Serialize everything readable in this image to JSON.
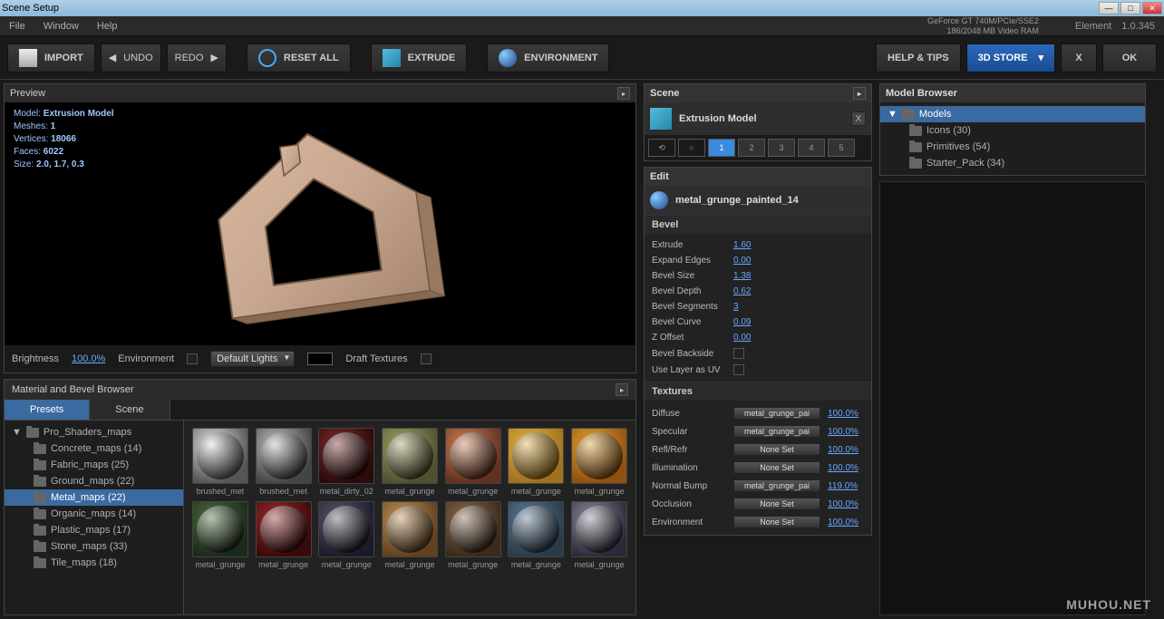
{
  "window": {
    "title": "Scene Setup"
  },
  "menubar": {
    "file": "File",
    "window": "Window",
    "help": "Help",
    "gpu": "GeForce GT 740M/PCIe/SSE2",
    "vram": "186/2048 MB Video RAM",
    "app": "Element",
    "ver": "1.0.345"
  },
  "toolbar": {
    "import": "IMPORT",
    "undo": "UNDO",
    "redo": "REDO",
    "reset": "RESET ALL",
    "extrude": "EXTRUDE",
    "environment": "ENVIRONMENT",
    "help_tips": "HELP & TIPS",
    "store": "3D STORE",
    "x": "X",
    "ok": "OK"
  },
  "preview": {
    "title": "Preview",
    "model_label": "Model:",
    "model": "Extrusion Model",
    "meshes_label": "Meshes:",
    "meshes": "1",
    "vertices_label": "Vertices:",
    "vertices": "18066",
    "faces_label": "Faces:",
    "faces": "6022",
    "size_label": "Size:",
    "size": "2.0, 1.7, 0.3",
    "brightness_label": "Brightness",
    "brightness": "100.0%",
    "env_label": "Environment",
    "lights": "Default Lights",
    "draft_label": "Draft Textures"
  },
  "material_panel": {
    "title": "Material and Bevel Browser",
    "tabs": {
      "presets": "Presets",
      "scene": "Scene"
    },
    "tree_root": "Pro_Shaders_maps",
    "folders": [
      {
        "label": "Concrete_maps (14)"
      },
      {
        "label": "Fabric_maps (25)"
      },
      {
        "label": "Ground_maps (22)"
      },
      {
        "label": "Metal_maps (22)",
        "selected": true
      },
      {
        "label": "Organic_maps (14)"
      },
      {
        "label": "Plastic_maps (17)"
      },
      {
        "label": "Stone_maps (33)"
      },
      {
        "label": "Tile_maps (18)"
      }
    ],
    "thumbs": [
      {
        "label": "brushed_met",
        "c1": "#ddd",
        "c2": "#555"
      },
      {
        "label": "brushed_met",
        "c1": "#bbb",
        "c2": "#444"
      },
      {
        "label": "metal_dirty_02",
        "c1": "#7a2a2a",
        "c2": "#2a0a0a"
      },
      {
        "label": "metal_grunge",
        "c1": "#a0a060",
        "c2": "#505030"
      },
      {
        "label": "metal_grunge",
        "c1": "#d08050",
        "c2": "#603020"
      },
      {
        "label": "metal_grunge",
        "c1": "#e0b040",
        "c2": "#a07020"
      },
      {
        "label": "metal_grunge",
        "c1": "#e0a030",
        "c2": "#905010"
      },
      {
        "label": "metal_grunge",
        "c1": "#4a6a3a",
        "c2": "#1a2a1a"
      },
      {
        "label": "metal_grunge",
        "c1": "#9a2a2a",
        "c2": "#3a0a0a"
      },
      {
        "label": "metal_grunge",
        "c1": "#5a5a6a",
        "c2": "#1a1a2a"
      },
      {
        "label": "metal_grunge",
        "c1": "#c09050",
        "c2": "#604020"
      },
      {
        "label": "metal_grunge",
        "c1": "#8a6a4a",
        "c2": "#3a2a1a"
      },
      {
        "label": "metal_grunge",
        "c1": "#5a7a9a",
        "c2": "#2a3a4a"
      },
      {
        "label": "metal_grunge",
        "c1": "#8a8a9a",
        "c2": "#2a2a3a"
      }
    ]
  },
  "scene": {
    "title": "Scene",
    "object": "Extrusion Model",
    "slots": [
      "1",
      "2",
      "3",
      "4",
      "5"
    ]
  },
  "edit": {
    "title": "Edit",
    "material": "metal_grunge_painted_14",
    "bevel_title": "Bevel",
    "props": [
      {
        "label": "Extrude",
        "val": "1.60"
      },
      {
        "label": "Expand Edges",
        "val": "0.00"
      },
      {
        "label": "Bevel Size",
        "val": "1.38"
      },
      {
        "label": "Bevel Depth",
        "val": "0.62"
      },
      {
        "label": "Bevel Segments",
        "val": "3"
      },
      {
        "label": "Bevel Curve",
        "val": "0.09"
      },
      {
        "label": "Z Offset",
        "val": "0.00"
      },
      {
        "label": "Bevel Backside",
        "checkbox": true
      },
      {
        "label": "Use Layer as UV",
        "checkbox": true
      }
    ],
    "textures_title": "Textures",
    "textures": [
      {
        "label": "Diffuse",
        "btn": "metal_grunge_pai",
        "pct": "100.0%"
      },
      {
        "label": "Specular",
        "btn": "metal_grunge_pai",
        "pct": "100.0%"
      },
      {
        "label": "Refl/Refr",
        "btn": "None Set",
        "pct": "100.0%"
      },
      {
        "label": "Illumination",
        "btn": "None Set",
        "pct": "100.0%"
      },
      {
        "label": "Normal Bump",
        "btn": "metal_grunge_pai",
        "pct": "119.0%"
      },
      {
        "label": "Occlusion",
        "btn": "None Set",
        "pct": "100.0%"
      },
      {
        "label": "Environment",
        "btn": "None Set",
        "pct": "100.0%"
      }
    ]
  },
  "model_browser": {
    "title": "Model Browser",
    "root": "Models",
    "items": [
      "Icons (30)",
      "Primitives (54)",
      "Starter_Pack (34)"
    ]
  },
  "watermark": "MUHOU.NET"
}
